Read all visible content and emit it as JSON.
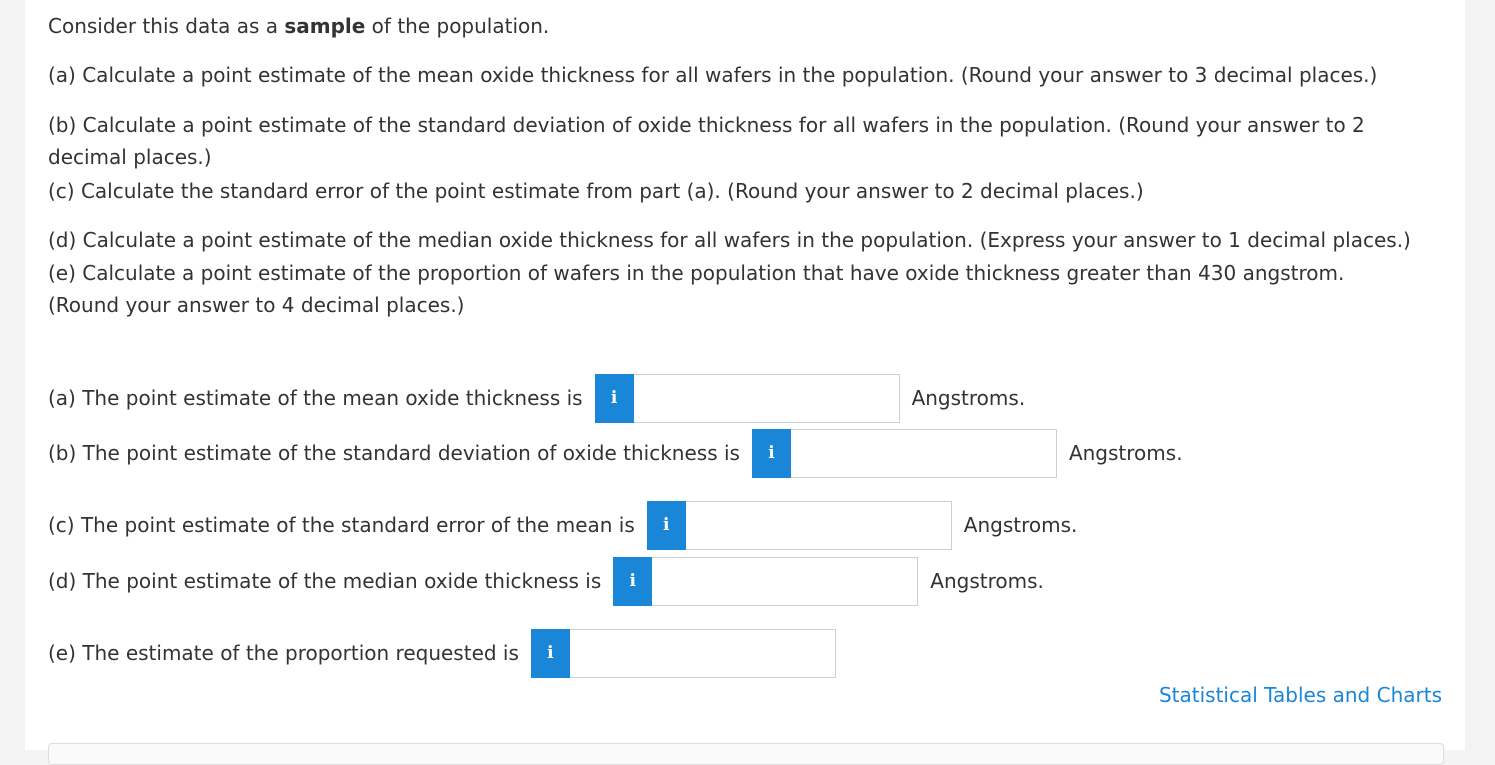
{
  "intro": {
    "before": "Consider this data as a ",
    "bold": "sample",
    "after": " of the population."
  },
  "questions": {
    "a": "(a) Calculate a point estimate of the mean oxide thickness for all wafers in the population. (Round your answer to 3 decimal places.)",
    "b_line1": "(b) Calculate a point estimate of the standard deviation of oxide thickness for all wafers in the population. (Round your answer to 2",
    "b_line2": "decimal places.)",
    "c": "(c) Calculate the standard error of the point estimate from part (a). (Round your answer to 2 decimal places.)",
    "d": "(d) Calculate a point estimate of the median oxide thickness for all wafers in the population. (Express your answer to 1 decimal places.)",
    "e_line1": "(e) Calculate a point estimate of the proportion of wafers in the population that have oxide thickness greater than 430 angstrom.",
    "e_line2": "(Round your answer to 4 decimal places.)"
  },
  "answers": [
    {
      "label": "(a) The point estimate of the mean oxide thickness is",
      "value": "",
      "unit": "Angstroms."
    },
    {
      "label": "(b) The point estimate of the standard deviation of oxide thickness is",
      "value": "",
      "unit": "Angstroms."
    },
    {
      "label": "(c) The point estimate of the standard error of the mean is",
      "value": "",
      "unit": "Angstroms."
    },
    {
      "label": "(d) The point estimate of the median oxide thickness is",
      "value": "",
      "unit": "Angstroms."
    },
    {
      "label": "(e) The estimate of the proportion requested is",
      "value": "",
      "unit": ""
    }
  ],
  "info_icon_glyph": "i",
  "link": {
    "label": "Statistical Tables and Charts"
  },
  "colors": {
    "accent": "#1a86d8",
    "text": "#333333",
    "border": "#cfcfcf"
  }
}
